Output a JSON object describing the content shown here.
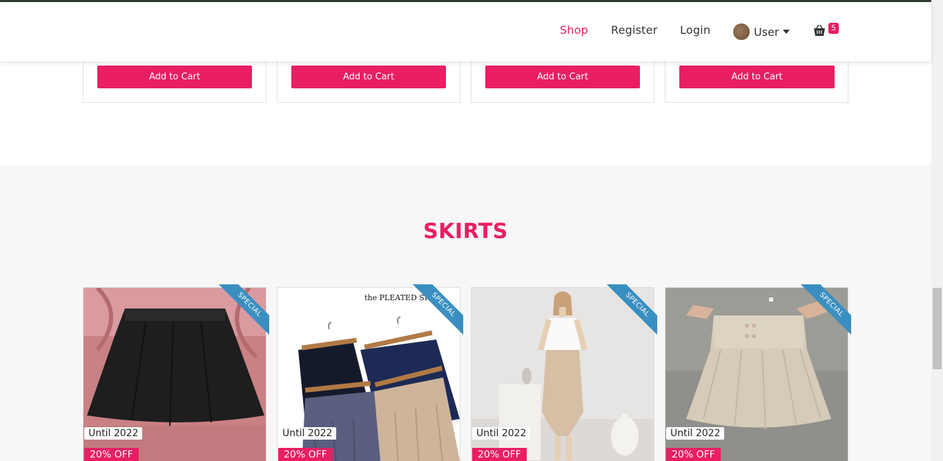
{
  "nav": {
    "shop": "Shop",
    "register": "Register",
    "login": "Login",
    "user": "User",
    "cart_count": "5"
  },
  "top_products": {
    "add_to_cart": [
      "Add to Cart",
      "Add to Cart",
      "Add to Cart",
      "Add to Cart"
    ]
  },
  "skirts": {
    "title": "SKIRTS",
    "items": [
      {
        "ribbon": "SPECIAL",
        "until": "Until 2022",
        "discount": "20% OFF",
        "overlay_text": ""
      },
      {
        "ribbon": "SPECIAL",
        "until": "Until 2022",
        "discount": "20% OFF",
        "overlay_text": "the PLEATED SKI"
      },
      {
        "ribbon": "SPECIAL",
        "until": "Until 2022",
        "discount": "20% OFF",
        "overlay_text": ""
      },
      {
        "ribbon": "SPECIAL",
        "until": "Until 2022",
        "discount": "20% OFF",
        "overlay_text": ""
      }
    ]
  },
  "colors": {
    "accent": "#e91e63",
    "ribbon": "#3a8fc0",
    "page_bg": "#f7f7f7"
  }
}
